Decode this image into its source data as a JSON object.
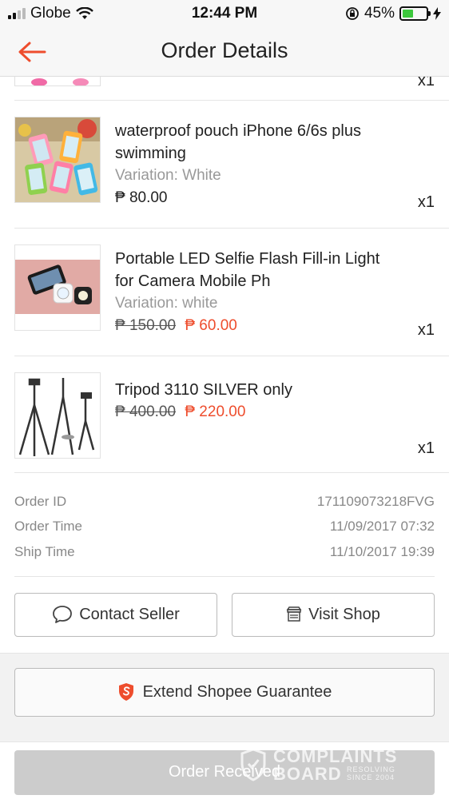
{
  "status_bar": {
    "carrier": "Globe",
    "time": "12:44 PM",
    "battery_percent": "45%",
    "battery_level": 0.45
  },
  "header": {
    "title": "Order Details",
    "back_icon": "arrow-left-icon",
    "accent_color": "#ee4d2d"
  },
  "partial_item": {
    "quantity": "x1"
  },
  "items": [
    {
      "name": "waterproof pouch iPhone 6/6s plus swimming",
      "variation": "Variation: White",
      "price": "₱ 80.00",
      "quantity": "x1"
    },
    {
      "name": "Portable LED Selfie Flash Fill-in Light for Camera Mobile Ph",
      "variation": "Variation: white",
      "original_price": "₱ 150.00",
      "sale_price": "₱ 60.00",
      "quantity": "x1"
    },
    {
      "name": "Tripod 3110 SILVER only",
      "original_price": "₱ 400.00",
      "sale_price": "₱ 220.00",
      "quantity": "x1"
    }
  ],
  "order_info": {
    "order_id_label": "Order ID",
    "order_id_value": "171109073218FVG",
    "order_time_label": "Order Time",
    "order_time_value": "11/09/2017 07:32",
    "ship_time_label": "Ship Time",
    "ship_time_value": "11/10/2017 19:39"
  },
  "actions": {
    "contact_seller": "Contact Seller",
    "visit_shop": "Visit Shop",
    "extend_guarantee": "Extend Shopee Guarantee",
    "order_received": "Order Received"
  },
  "watermark": {
    "line1": "COMPLAINTS",
    "line2": "BOARD",
    "tagline1": "RESOLVING",
    "tagline2": "SINCE 2004"
  }
}
